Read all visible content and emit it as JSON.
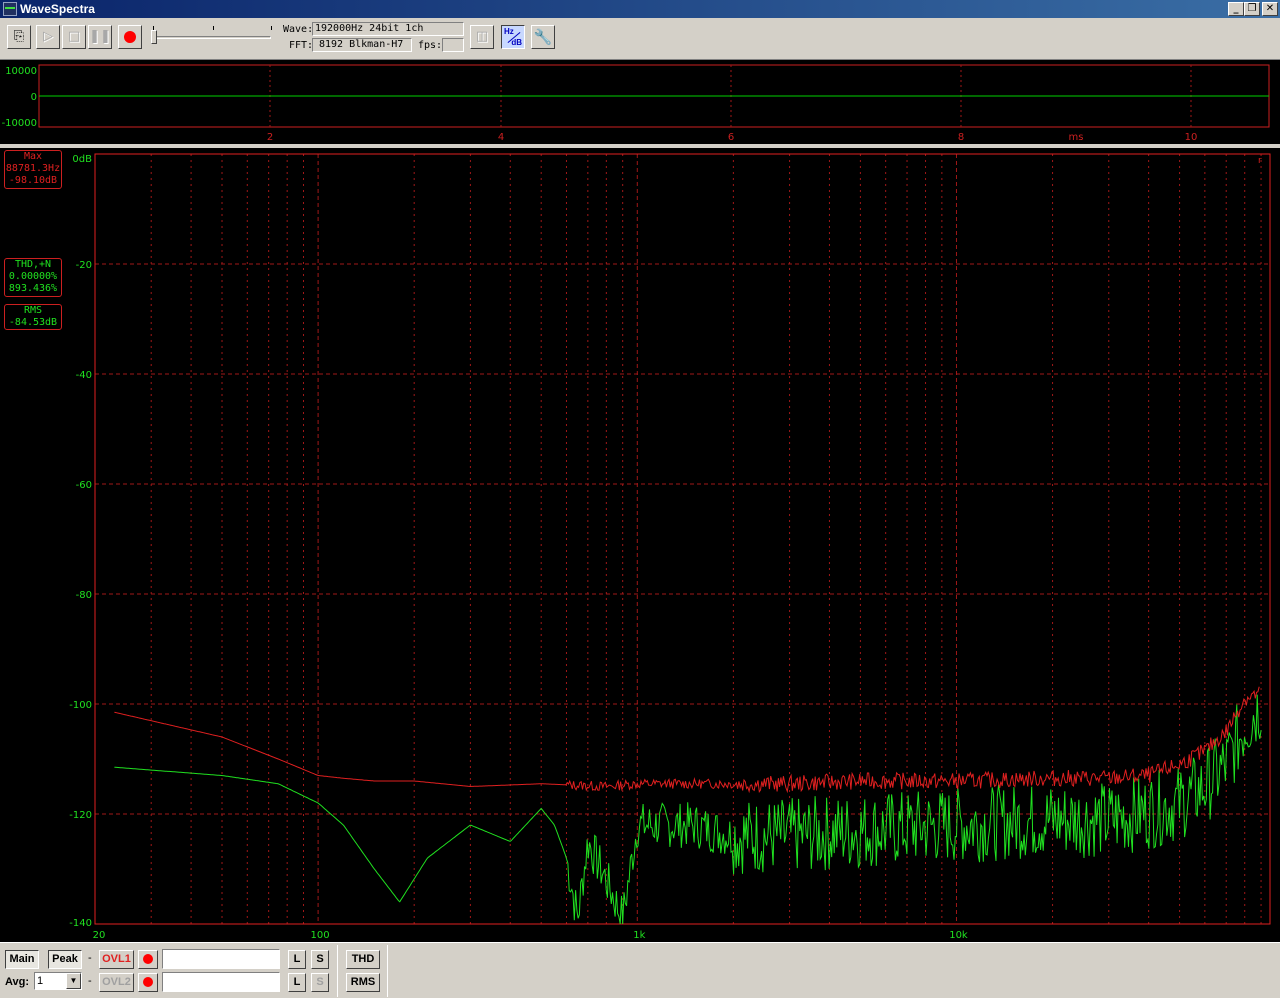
{
  "window": {
    "title": "WaveSpectra",
    "controls": [
      "_",
      "❐",
      "✕"
    ]
  },
  "toolbar": {
    "wave_label": "Wave:",
    "wave_value": "192000Hz 24bit 1ch",
    "fft_label": "FFT:",
    "fft_value": "8192 Blkman-H7",
    "fps_label": "fps:",
    "fps_value": "",
    "hzdb_top": "Hz",
    "hzdb_bottom": "dB"
  },
  "wave_graph": {
    "y_ticks": [
      "10000",
      "0",
      "-10000"
    ],
    "x_ticks": [
      "2",
      "4",
      "6",
      "8",
      "10"
    ],
    "x_unit": "ms",
    "trace_color": "#00d000",
    "frame_color": "#cc2020"
  },
  "spectrum_graph": {
    "y_ticks": [
      "0dB",
      "-20",
      "-40",
      "-60",
      "-80",
      "-100",
      "-120",
      "-140"
    ],
    "x_ticks": [
      "20",
      "100",
      "1k",
      "10k"
    ],
    "corner_marker": "r",
    "max_box": {
      "label": "Max",
      "freq": "88781.3Hz",
      "level": "-98.10dB"
    },
    "thd_box": {
      "label": "THD,+N",
      "line1": "0.00000%",
      "line2": "893.436%"
    },
    "rms_box": {
      "label": "RMS",
      "value": "-84.53dB"
    },
    "colors": {
      "peak": "#e02020",
      "main": "#20e020",
      "grid": "#a01818"
    }
  },
  "chart_data": {
    "type": "line",
    "xscale": "log",
    "xlim": [
      20,
      96000
    ],
    "ylim": [
      -140,
      0
    ],
    "series": [
      {
        "role": "peak",
        "x": [
          23,
          50,
          75,
          100,
          120,
          150,
          200,
          300,
          500,
          800,
          1000,
          2000,
          3000,
          5000,
          10000,
          20000,
          30000,
          40000,
          50000,
          60000,
          70000,
          80000,
          88781
        ],
        "y": [
          -101.5,
          -106,
          -110,
          -113,
          -113.5,
          -114,
          -114,
          -115,
          -114.5,
          -115,
          -114.5,
          -114.5,
          -114.5,
          -114,
          -114,
          -113.5,
          -113.5,
          -113,
          -111,
          -108.5,
          -105,
          -99,
          -98.1
        ]
      },
      {
        "role": "main",
        "x": [
          23,
          50,
          75,
          100,
          120,
          150,
          180,
          220,
          300,
          400,
          500,
          550,
          600,
          650,
          700,
          800,
          900,
          1000,
          1500,
          2000,
          3000,
          5000,
          10000,
          20000,
          30000,
          40000,
          50000,
          60000,
          70000,
          80000,
          90000
        ],
        "y": [
          -111.5,
          -113,
          -114.5,
          -118,
          -122,
          -130,
          -136,
          -128,
          -122,
          -125,
          -119,
          -122,
          -128,
          -139,
          -125,
          -132,
          -139,
          -122,
          -122,
          -124,
          -124,
          -123,
          -122,
          -121,
          -121,
          -119.5,
          -118,
          -115,
          -111,
          -104,
          -100
        ]
      }
    ]
  },
  "bottom": {
    "main": "Main",
    "peak": "Peak",
    "ovl1": "OVL1",
    "ovl2": "OVL2",
    "avg_label": "Avg:",
    "avg_value": "1",
    "l": "L",
    "s": "S",
    "thd": "THD",
    "rms": "RMS",
    "dash": "-"
  }
}
